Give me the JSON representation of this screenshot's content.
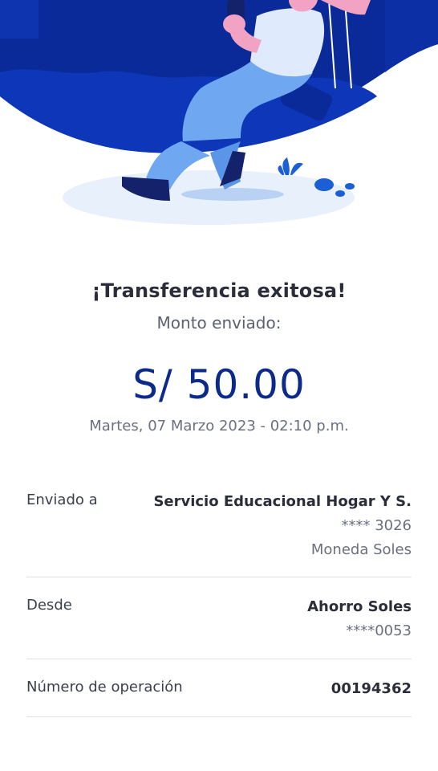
{
  "result": {
    "title": "¡Transferencia exitosa!",
    "subtitle": "Monto enviado:",
    "amount": "S/ 50.00",
    "datetime": "Martes, 07 Marzo 2023 - 02:10 p.m."
  },
  "details": {
    "sent_to": {
      "label": "Enviado a",
      "name": "Servicio Educacional Hogar Y S.",
      "account": "**** 3026",
      "currency": "Moneda Soles"
    },
    "from": {
      "label": "Desde",
      "account_name": "Ahorro Soles",
      "account": "****0053"
    },
    "operation": {
      "label": "Número de operación",
      "number": "00194362"
    }
  },
  "colors": {
    "brand_blue": "#0b2a8a",
    "hero_dark": "#0a2a9a",
    "accent_pink": "#f2a3c4",
    "accent_light_blue": "#6fa8f0"
  },
  "icons": {
    "hero": "person-on-swing-illustration"
  }
}
